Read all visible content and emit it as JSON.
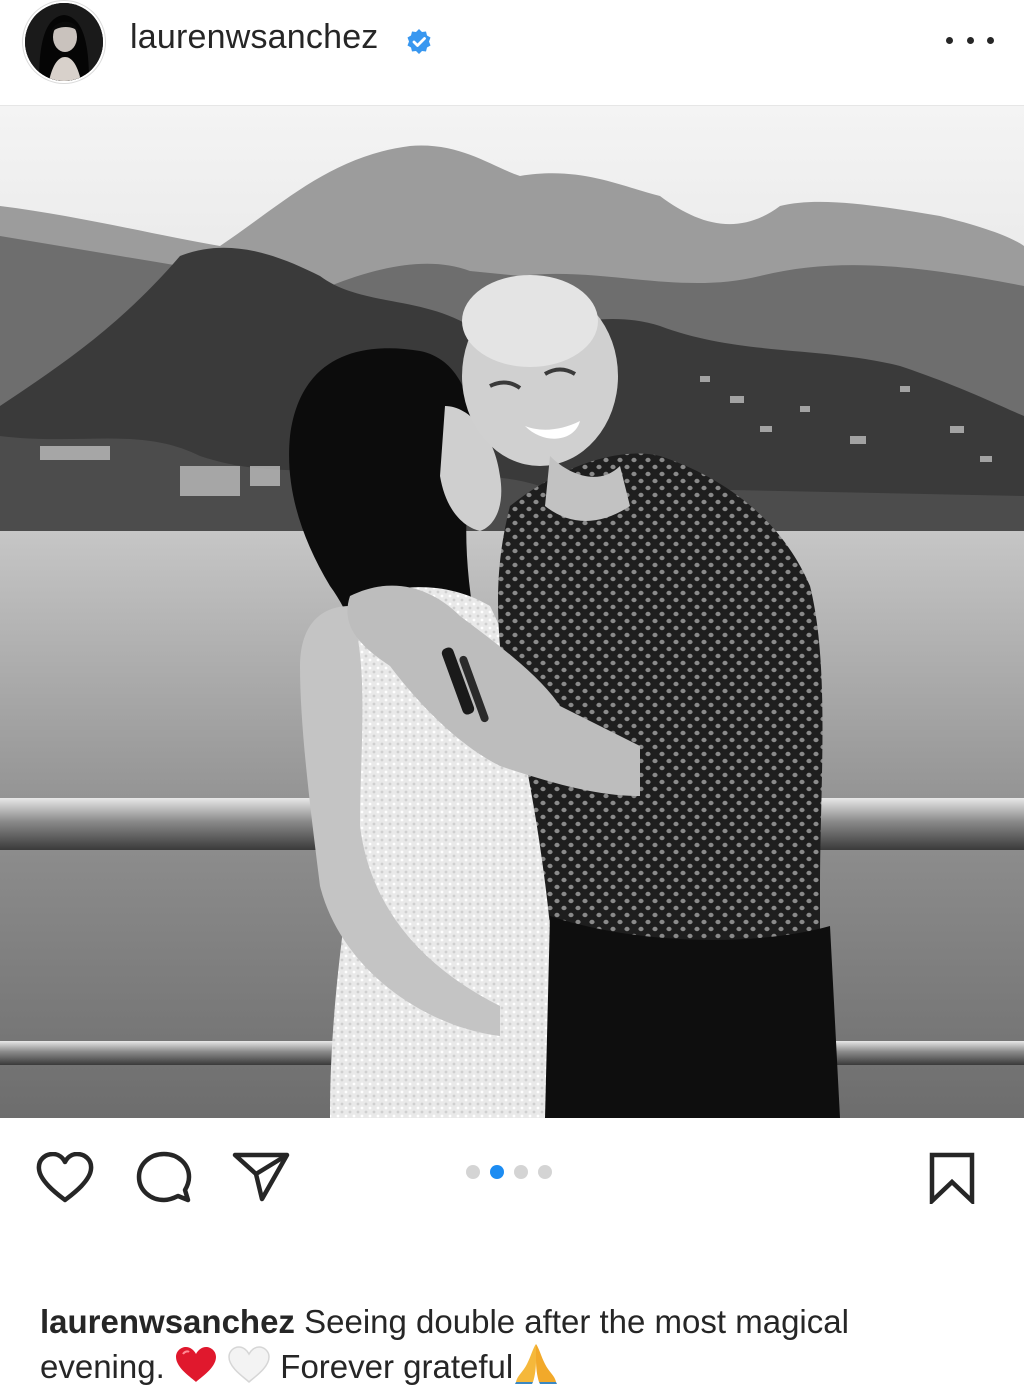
{
  "header": {
    "username": "laurenwsanchez",
    "verified": true,
    "more_icon": "more-horizontal-icon"
  },
  "carousel": {
    "total": 4,
    "active_index": 1,
    "active_color": "#1c8cf2",
    "inactive_color": "#d4d4d4"
  },
  "actions": {
    "like_icon": "heart-icon",
    "comment_icon": "comment-icon",
    "share_icon": "paper-plane-icon",
    "save_icon": "bookmark-icon"
  },
  "caption": {
    "username": "laurenwsanchez",
    "text_part1": "Seeing double after the most magical evening.",
    "emoji1": "red-heart-emoji",
    "emoji2": "white-heart-emoji",
    "text_part2": "Forever grateful",
    "emoji3": "folded-hands-emoji"
  }
}
